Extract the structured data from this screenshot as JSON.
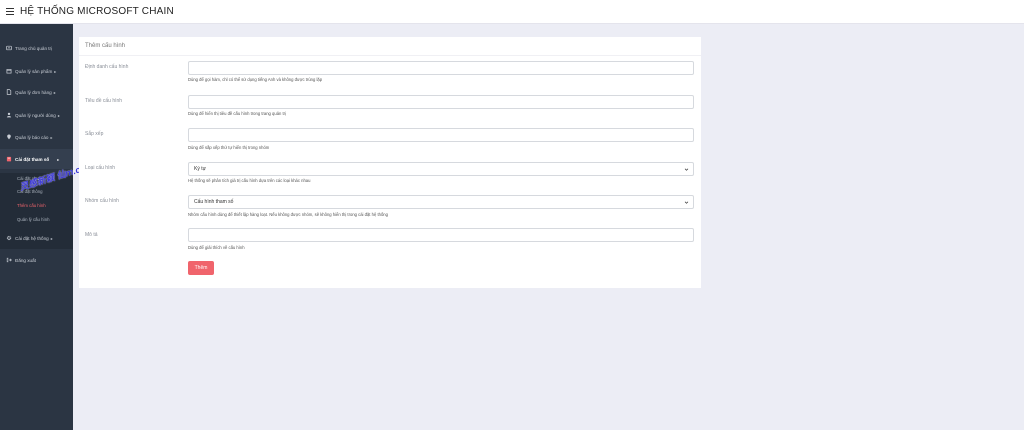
{
  "app": {
    "title": "HỆ THỐNG MICROSOFT CHAIN"
  },
  "sidebar": {
    "items": [
      {
        "label": "Trang chủ quản trị",
        "icon": "dashboard-icon",
        "caret": ""
      },
      {
        "label": "Quản lý sản phẩm",
        "icon": "box-icon",
        "caret": "▸"
      },
      {
        "label": "Quản lý đơn hàng",
        "icon": "document-icon",
        "caret": "▸"
      },
      {
        "label": "Quản lý người dùng",
        "icon": "user-icon",
        "caret": "▸"
      },
      {
        "label": "Quản lý báo cáo",
        "icon": "map-pin-icon",
        "caret": "▸"
      },
      {
        "label": "Cài đặt tham số",
        "icon": "settings-book-icon",
        "caret": "▸"
      },
      {
        "label": "Cài đặt hệ thống",
        "icon": "gear-icon",
        "caret": "▸"
      },
      {
        "label": "Đăng xuất",
        "icon": "logout-icon",
        "caret": ""
      }
    ],
    "submenu": [
      {
        "label": "Cài đặt chung"
      },
      {
        "label": "Cài đặt thông"
      },
      {
        "label": "Thêm cấu hình"
      },
      {
        "label": "Quản lý cấu hình"
      }
    ],
    "watermark": "灵感新颖 仙m.cc"
  },
  "form": {
    "title": "Thêm cấu hình",
    "fields": [
      {
        "label": "Định danh cấu hình",
        "value": "",
        "help": "Dùng để gọi hàm, chỉ có thể sử dụng tiếng Anh và không được trùng lặp"
      },
      {
        "label": "Tiêu đề cấu hình",
        "value": "",
        "help": "Dùng để hiển thị tiêu đề cấu hình trong trang quản trị"
      },
      {
        "label": "Sắp xếp",
        "value": "",
        "help": "Dùng để sắp xếp thứ tự hiển thị trong nhóm"
      },
      {
        "label": "Loại cấu hình",
        "value": "Ký tự",
        "help": "Hệ thống sẽ phân tích giá trị cấu hình dựa trên các loại khác nhau"
      },
      {
        "label": "Nhóm cấu hình",
        "value": "Cấu hình tham số",
        "help": "Nhóm cấu hình dùng để thiết lập hàng loạt. Nếu không được nhóm, sẽ không hiển thị trong cài đặt hệ thống"
      },
      {
        "label": "Mô tả",
        "value": "",
        "help": "Dùng để giải thích về cấu hình"
      }
    ],
    "submit_label": "Thêm"
  },
  "colors": {
    "sidebar_bg": "#2b3543",
    "accent": "#f0646c",
    "page_bg": "#ecedf5"
  }
}
